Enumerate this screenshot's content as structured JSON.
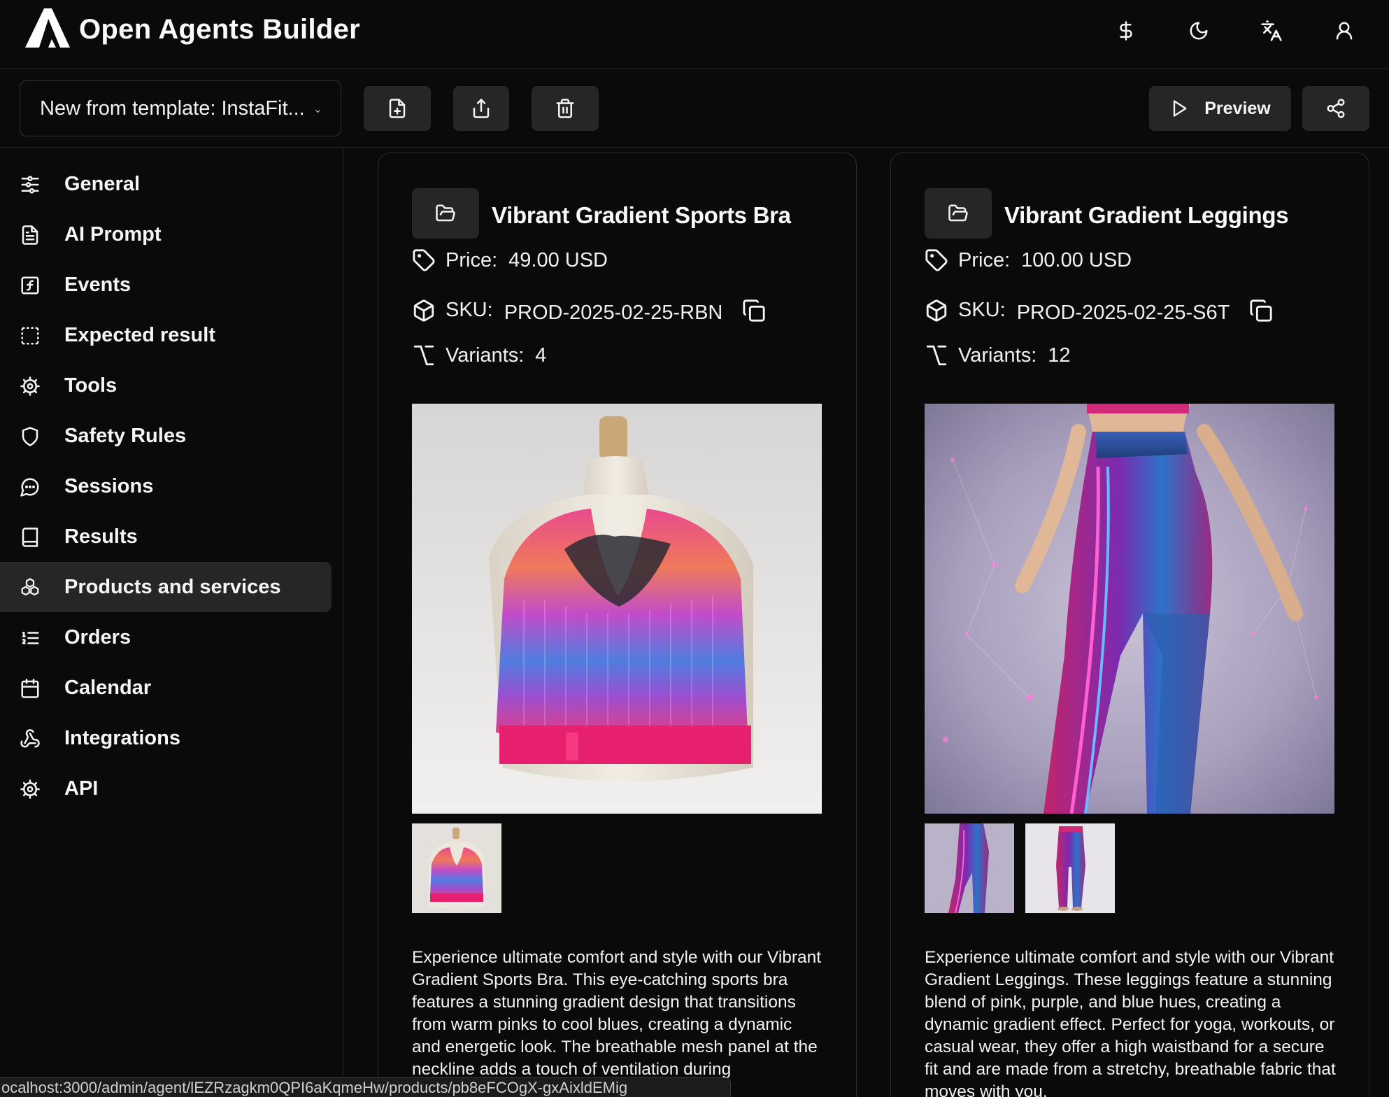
{
  "app": {
    "title": "Open Agents Builder"
  },
  "header_icons": [
    "dollar-icon",
    "moon-icon",
    "translate-icon",
    "user-icon"
  ],
  "toolbar": {
    "template_select": "New from template: InstaFit...",
    "preview_label": "Preview"
  },
  "sidebar": {
    "items": [
      {
        "label": "General",
        "icon": "sliders-icon"
      },
      {
        "label": "AI Prompt",
        "icon": "document-icon"
      },
      {
        "label": "Events",
        "icon": "function-icon"
      },
      {
        "label": "Expected result",
        "icon": "dashed-square-icon"
      },
      {
        "label": "Tools",
        "icon": "cog-icon"
      },
      {
        "label": "Safety Rules",
        "icon": "shield-icon"
      },
      {
        "label": "Sessions",
        "icon": "chat-icon"
      },
      {
        "label": "Results",
        "icon": "book-icon"
      },
      {
        "label": "Products and services",
        "icon": "boxes-icon",
        "active": true
      },
      {
        "label": "Orders",
        "icon": "list-icon"
      },
      {
        "label": "Calendar",
        "icon": "calendar-icon"
      },
      {
        "label": "Integrations",
        "icon": "webhook-icon"
      },
      {
        "label": "API",
        "icon": "cog-icon"
      }
    ]
  },
  "labels": {
    "price": "Price:",
    "sku": "SKU:",
    "variants": "Variants:"
  },
  "products": [
    {
      "title": "Vibrant Gradient Sports Bra",
      "price": "49.00 USD",
      "sku": "PROD-2025-02-25-RBN",
      "variants": "4",
      "description": "Experience ultimate comfort and style with our Vibrant Gradient Sports Bra. This eye-catching sports bra features a stunning gradient design that transitions from warm pinks to cool blues, creating a dynamic and energetic look. The breathable mesh panel at the neckline adds a touch of ventilation during"
    },
    {
      "title": "Vibrant Gradient Leggings",
      "price": "100.00 USD",
      "sku": "PROD-2025-02-25-S6T",
      "variants": "12",
      "description": "Experience ultimate comfort and style with our Vibrant Gradient Leggings. These leggings feature a stunning blend of pink, purple, and blue hues, creating a dynamic gradient effect. Perfect for yoga, workouts, or casual wear, they offer a high waistband for a secure fit and are made from a stretchy, breathable fabric that moves with you."
    }
  ],
  "status_bar": {
    "url": "ocalhost:3000/admin/agent/lEZRzagkm0QPI6aKqmeHw/products/pb8eFCOgX-gxAixldEMig"
  },
  "colors": {
    "background": "#0a0a0a",
    "surface": "#262626",
    "border": "#2a2a2a",
    "text": "#f5f5f5"
  }
}
